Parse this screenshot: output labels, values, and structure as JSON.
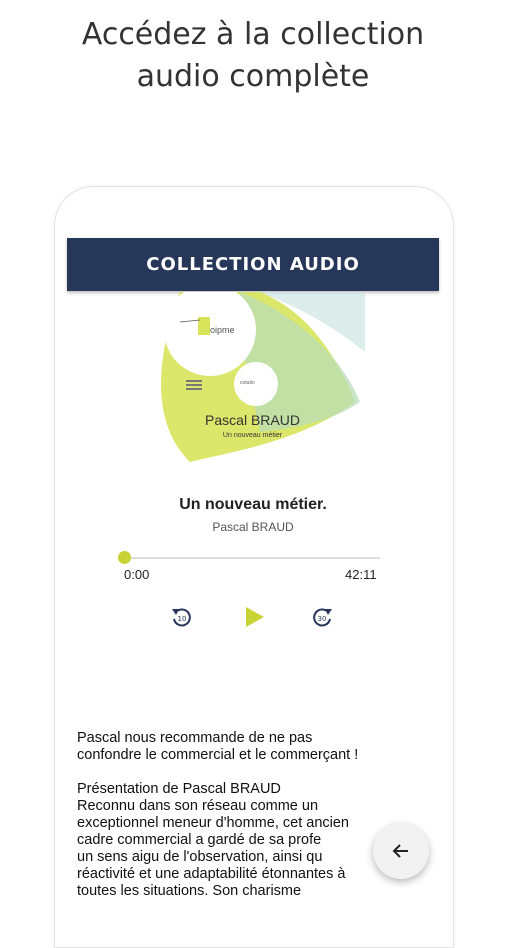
{
  "headline": {
    "line1": "Accédez à la collection",
    "line2": "audio complète"
  },
  "appbar": {
    "title": "COLLECTION AUDIO"
  },
  "artwork": {
    "logo_text": "oipme",
    "cd_label": "cotatio",
    "name": "Pascal BRAUD",
    "subtitle": "Un nouveau métier"
  },
  "track": {
    "title": "Un nouveau métier.",
    "author": "Pascal BRAUD"
  },
  "player": {
    "current_time": "0:00",
    "total_time": "42:11",
    "progress": 0.0,
    "rewind_icon": "rewind-10-icon",
    "play_icon": "play-icon",
    "forward_icon": "forward-30-icon",
    "accent_color": "#c7d335"
  },
  "description": {
    "intro": [
      "Pascal nous recommande de ne pas",
      "confondre le commercial et le commerçant !"
    ],
    "body": [
      "Présentation de Pascal BRAUD",
      "Reconnu dans son réseau comme un",
      "exceptionnel meneur d'homme, cet ancien",
      "cadre commercial a gardé de sa profe",
      "un sens aigu de l'observation, ainsi qu",
      "réactivité et une adaptabilité étonnantes à",
      "toutes les situations. Son charisme"
    ]
  },
  "fab": {
    "icon": "arrow-left-icon"
  },
  "colors": {
    "appbar": "#26375a",
    "accent": "#c7d335"
  }
}
